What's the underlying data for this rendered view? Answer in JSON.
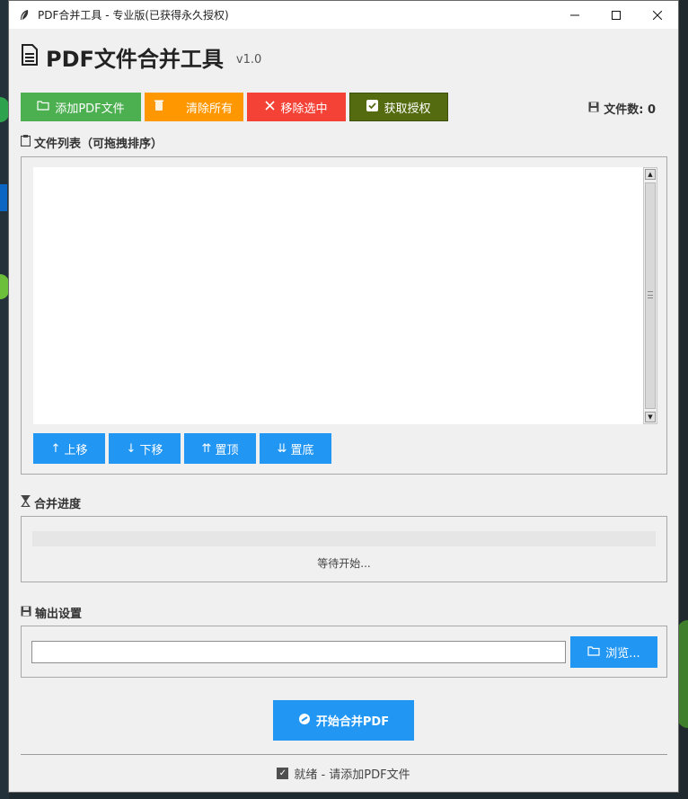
{
  "window": {
    "title": "PDF合并工具 - 专业版(已获得永久授权)",
    "title_icon": "feather-icon",
    "controls": {
      "minimize": "—",
      "maximize": "☐",
      "close": "✕"
    }
  },
  "header": {
    "icon": "document-icon",
    "title": "PDF文件合并工具",
    "version": "v1.0"
  },
  "toolbar": {
    "add_label": "添加PDF文件",
    "clear_label": "清除所有",
    "remove_label": "移除选中",
    "license_label": "获取授权",
    "file_count_label": "文件数: 0"
  },
  "file_list": {
    "label": "文件列表（可拖拽排序）",
    "items": []
  },
  "move_buttons": {
    "up": "上移",
    "down": "下移",
    "top": "置顶",
    "bottom": "置底"
  },
  "progress": {
    "label": "合并进度",
    "value": 0,
    "status": "等待开始..."
  },
  "output": {
    "label": "输出设置",
    "path_value": "",
    "browse_label": "浏览..."
  },
  "merge_button": {
    "label": "开始合并PDF"
  },
  "status_bar": {
    "text": "就绪 - 请添加PDF文件"
  },
  "colors": {
    "green": "#4caf50",
    "orange": "#ff9800",
    "red": "#f44336",
    "olive": "#556b0f",
    "blue": "#2196f3"
  }
}
